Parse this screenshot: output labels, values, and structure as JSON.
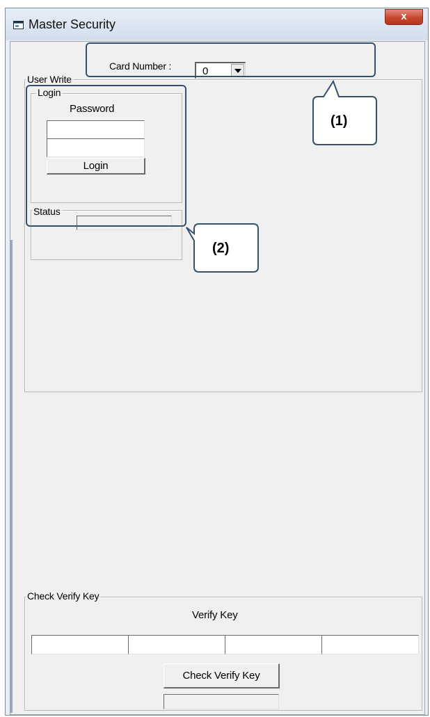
{
  "window": {
    "title": "Master Security",
    "close_glyph": "x"
  },
  "card_number": {
    "label": "Card Number :",
    "value": "0"
  },
  "user_write": {
    "group_label": "User Write",
    "login": {
      "group_label": "Login",
      "password_label": "Password",
      "password_field_1": "",
      "password_field_2": "",
      "login_button": "Login"
    },
    "status": {
      "group_label": "Status",
      "value": ""
    }
  },
  "check_verify_key": {
    "group_label": "Check Verify Key",
    "verify_key_label": "Verify Key",
    "key_fields": [
      "",
      "",
      "",
      ""
    ],
    "button": "Check Verify Key",
    "result": ""
  },
  "annotations": {
    "callout_1": "(1)",
    "callout_2": "(2)",
    "frame_color": "#34506e"
  },
  "icons": [
    "window-app-icon",
    "close-icon",
    "dropdown-arrow-icon"
  ]
}
